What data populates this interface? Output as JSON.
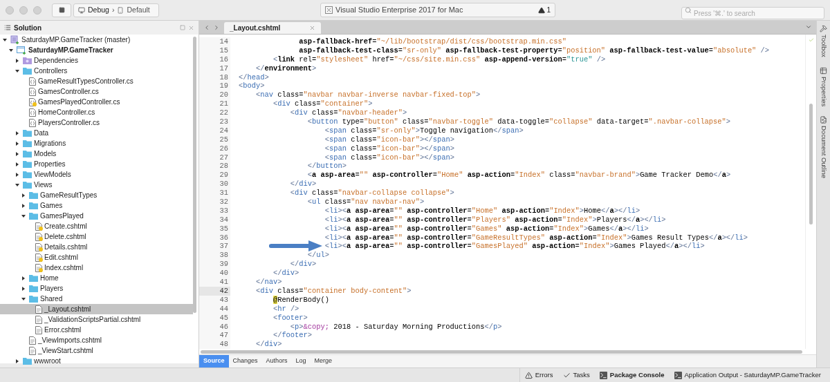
{
  "toolbar": {
    "configuration": "Debug",
    "separator": "›",
    "target": "Default",
    "status": "Visual Studio Enterprise 2017 for Mac",
    "warning_count": "1",
    "search": {
      "placeholder": "Press '⌘.' to search"
    }
  },
  "solution_pad": {
    "title": "Solution",
    "tree": [
      {
        "label": "SaturdayMP.GameTracker (master)",
        "kind": "solution",
        "expanded": true,
        "selected": false,
        "children": [
          {
            "label": "SaturdayMP.GameTracker",
            "kind": "project",
            "expanded": true,
            "selected": false,
            "children": [
              {
                "label": "Dependencies",
                "kind": "dependencies",
                "expanded": false,
                "selected": false
              },
              {
                "label": "Controllers",
                "kind": "folder",
                "expanded": true,
                "selected": false,
                "children": [
                  {
                    "label": "GameResultTypesController.cs",
                    "kind": "cs",
                    "modified": false,
                    "selected": false
                  },
                  {
                    "label": "GamesController.cs",
                    "kind": "cs",
                    "modified": false,
                    "selected": false
                  },
                  {
                    "label": "GamesPlayedController.cs",
                    "kind": "cs",
                    "modified": true,
                    "selected": false
                  },
                  {
                    "label": "HomeController.cs",
                    "kind": "cs",
                    "modified": false,
                    "selected": false
                  },
                  {
                    "label": "PlayersController.cs",
                    "kind": "cs",
                    "modified": false,
                    "selected": false
                  }
                ]
              },
              {
                "label": "Data",
                "kind": "folder",
                "expanded": false,
                "selected": false
              },
              {
                "label": "Migrations",
                "kind": "folder",
                "expanded": false,
                "selected": false
              },
              {
                "label": "Models",
                "kind": "folder",
                "expanded": false,
                "selected": false
              },
              {
                "label": "Properties",
                "kind": "folder",
                "expanded": false,
                "selected": false
              },
              {
                "label": "ViewModels",
                "kind": "folder",
                "expanded": false,
                "selected": false
              },
              {
                "label": "Views",
                "kind": "folder",
                "expanded": true,
                "selected": false,
                "children": [
                  {
                    "label": "GameResultTypes",
                    "kind": "folder",
                    "expanded": false,
                    "selected": false
                  },
                  {
                    "label": "Games",
                    "kind": "folder",
                    "expanded": false,
                    "selected": false
                  },
                  {
                    "label": "GamesPlayed",
                    "kind": "folder",
                    "expanded": true,
                    "selected": false,
                    "children": [
                      {
                        "label": "Create.cshtml",
                        "kind": "cshtml",
                        "modified": true,
                        "selected": false
                      },
                      {
                        "label": "Delete.cshtml",
                        "kind": "cshtml",
                        "modified": true,
                        "selected": false
                      },
                      {
                        "label": "Details.cshtml",
                        "kind": "cshtml",
                        "modified": true,
                        "selected": false
                      },
                      {
                        "label": "Edit.cshtml",
                        "kind": "cshtml",
                        "modified": true,
                        "selected": false
                      },
                      {
                        "label": "Index.cshtml",
                        "kind": "cshtml",
                        "modified": true,
                        "selected": false
                      }
                    ]
                  },
                  {
                    "label": "Home",
                    "kind": "folder",
                    "expanded": false,
                    "selected": false
                  },
                  {
                    "label": "Players",
                    "kind": "folder",
                    "expanded": false,
                    "selected": false
                  },
                  {
                    "label": "Shared",
                    "kind": "folder",
                    "expanded": true,
                    "selected": false,
                    "children": [
                      {
                        "label": "_Layout.cshtml",
                        "kind": "cshtml",
                        "modified": false,
                        "selected": true
                      },
                      {
                        "label": "_ValidationScriptsPartial.cshtml",
                        "kind": "cshtml",
                        "modified": false,
                        "selected": false
                      },
                      {
                        "label": "Error.cshtml",
                        "kind": "cshtml",
                        "modified": false,
                        "selected": false
                      }
                    ]
                  },
                  {
                    "label": "_ViewImports.cshtml",
                    "kind": "cshtml",
                    "modified": false,
                    "selected": false
                  },
                  {
                    "label": "_ViewStart.cshtml",
                    "kind": "cshtml",
                    "modified": false,
                    "selected": false
                  }
                ]
              },
              {
                "label": "wwwroot",
                "kind": "folder",
                "expanded": false,
                "selected": false
              }
            ]
          }
        ]
      }
    ]
  },
  "editor": {
    "tabs": [
      {
        "label": "_Layout.cshtml",
        "selected": true
      }
    ],
    "lines": [
      {
        "number": "14",
        "current": false,
        "marked": false,
        "tokens": [
          {
            "kind": "hattr",
            "text": "              asp-fallback-href"
          },
          {
            "kind": "text",
            "text": "="
          },
          {
            "kind": "string",
            "text": "\"~/lib/bootstrap/dist/css/bootstrap.min.css\""
          }
        ]
      },
      {
        "number": "15",
        "current": false,
        "marked": false,
        "tokens": [
          {
            "kind": "hattr",
            "text": "              asp-fallback-test-class"
          },
          {
            "kind": "text",
            "text": "="
          },
          {
            "kind": "string",
            "text": "\"sr-only\""
          },
          {
            "kind": "hattr",
            "text": " asp-fallback-test-property"
          },
          {
            "kind": "text",
            "text": "="
          },
          {
            "kind": "string",
            "text": "\"position\""
          },
          {
            "kind": "hattr",
            "text": " asp-fallback-test-value"
          },
          {
            "kind": "text",
            "text": "="
          },
          {
            "kind": "string",
            "text": "\"absolute\""
          },
          {
            "kind": "punct",
            "text": " />"
          }
        ]
      },
      {
        "number": "16",
        "current": false,
        "marked": false,
        "tokens": [
          {
            "kind": "punct",
            "text": "        <"
          },
          {
            "kind": "helper",
            "text": "link"
          },
          {
            "kind": "attr",
            "text": " rel"
          },
          {
            "kind": "text",
            "text": "="
          },
          {
            "kind": "string",
            "text": "\"stylesheet\""
          },
          {
            "kind": "attr",
            "text": " href"
          },
          {
            "kind": "text",
            "text": "="
          },
          {
            "kind": "string",
            "text": "\"~/css/site.min.css\""
          },
          {
            "kind": "hattr",
            "text": " asp-append-version"
          },
          {
            "kind": "text",
            "text": "="
          },
          {
            "kind": "literal",
            "text": "\"true\""
          },
          {
            "kind": "punct",
            "text": " />"
          }
        ]
      },
      {
        "number": "17",
        "current": false,
        "marked": false,
        "tokens": [
          {
            "kind": "punct",
            "text": "    </"
          },
          {
            "kind": "helper",
            "text": "environment"
          },
          {
            "kind": "punct",
            "text": ">"
          }
        ]
      },
      {
        "number": "18",
        "current": false,
        "marked": false,
        "tokens": [
          {
            "kind": "punct",
            "text": "</"
          },
          {
            "kind": "tag",
            "text": "head"
          },
          {
            "kind": "punct",
            "text": ">"
          }
        ]
      },
      {
        "number": "19",
        "current": false,
        "marked": false,
        "tokens": [
          {
            "kind": "punct",
            "text": "<"
          },
          {
            "kind": "tag",
            "text": "body"
          },
          {
            "kind": "punct",
            "text": ">"
          }
        ]
      },
      {
        "number": "20",
        "current": false,
        "marked": false,
        "tokens": [
          {
            "kind": "punct",
            "text": "    <"
          },
          {
            "kind": "tag",
            "text": "nav"
          },
          {
            "kind": "attr",
            "text": " class"
          },
          {
            "kind": "text",
            "text": "="
          },
          {
            "kind": "string",
            "text": "\"navbar navbar-inverse navbar-fixed-top\""
          },
          {
            "kind": "punct",
            "text": ">"
          }
        ]
      },
      {
        "number": "21",
        "current": false,
        "marked": false,
        "tokens": [
          {
            "kind": "punct",
            "text": "        <"
          },
          {
            "kind": "tag",
            "text": "div"
          },
          {
            "kind": "attr",
            "text": " class"
          },
          {
            "kind": "text",
            "text": "="
          },
          {
            "kind": "string",
            "text": "\"container\""
          },
          {
            "kind": "punct",
            "text": ">"
          }
        ]
      },
      {
        "number": "22",
        "current": false,
        "marked": false,
        "tokens": [
          {
            "kind": "punct",
            "text": "            <"
          },
          {
            "kind": "tag",
            "text": "div"
          },
          {
            "kind": "attr",
            "text": " class"
          },
          {
            "kind": "text",
            "text": "="
          },
          {
            "kind": "string",
            "text": "\"navbar-header\""
          },
          {
            "kind": "punct",
            "text": ">"
          }
        ]
      },
      {
        "number": "23",
        "current": false,
        "marked": false,
        "tokens": [
          {
            "kind": "punct",
            "text": "                <"
          },
          {
            "kind": "tag",
            "text": "button"
          },
          {
            "kind": "attr",
            "text": " type"
          },
          {
            "kind": "text",
            "text": "="
          },
          {
            "kind": "string",
            "text": "\"button\""
          },
          {
            "kind": "attr",
            "text": " class"
          },
          {
            "kind": "text",
            "text": "="
          },
          {
            "kind": "string",
            "text": "\"navbar-toggle\""
          },
          {
            "kind": "attr",
            "text": " data-toggle"
          },
          {
            "kind": "text",
            "text": "="
          },
          {
            "kind": "string",
            "text": "\"collapse\""
          },
          {
            "kind": "attr",
            "text": " data-target"
          },
          {
            "kind": "text",
            "text": "="
          },
          {
            "kind": "string",
            "text": "\".navbar-collapse\""
          },
          {
            "kind": "punct",
            "text": ">"
          }
        ]
      },
      {
        "number": "24",
        "current": false,
        "marked": false,
        "tokens": [
          {
            "kind": "punct",
            "text": "                    <"
          },
          {
            "kind": "tag",
            "text": "span"
          },
          {
            "kind": "attr",
            "text": " class"
          },
          {
            "kind": "text",
            "text": "="
          },
          {
            "kind": "string",
            "text": "\"sr-only\""
          },
          {
            "kind": "punct",
            "text": ">"
          },
          {
            "kind": "text",
            "text": "Toggle navigation"
          },
          {
            "kind": "punct",
            "text": "</"
          },
          {
            "kind": "tag",
            "text": "span"
          },
          {
            "kind": "punct",
            "text": ">"
          }
        ]
      },
      {
        "number": "25",
        "current": false,
        "marked": false,
        "tokens": [
          {
            "kind": "punct",
            "text": "                    <"
          },
          {
            "kind": "tag",
            "text": "span"
          },
          {
            "kind": "attr",
            "text": " class"
          },
          {
            "kind": "text",
            "text": "="
          },
          {
            "kind": "string",
            "text": "\"icon-bar\""
          },
          {
            "kind": "punct",
            "text": "></"
          },
          {
            "kind": "tag",
            "text": "span"
          },
          {
            "kind": "punct",
            "text": ">"
          }
        ]
      },
      {
        "number": "26",
        "current": false,
        "marked": false,
        "tokens": [
          {
            "kind": "punct",
            "text": "                    <"
          },
          {
            "kind": "tag",
            "text": "span"
          },
          {
            "kind": "attr",
            "text": " class"
          },
          {
            "kind": "text",
            "text": "="
          },
          {
            "kind": "string",
            "text": "\"icon-bar\""
          },
          {
            "kind": "punct",
            "text": "></"
          },
          {
            "kind": "tag",
            "text": "span"
          },
          {
            "kind": "punct",
            "text": ">"
          }
        ]
      },
      {
        "number": "27",
        "current": false,
        "marked": false,
        "tokens": [
          {
            "kind": "punct",
            "text": "                    <"
          },
          {
            "kind": "tag",
            "text": "span"
          },
          {
            "kind": "attr",
            "text": " class"
          },
          {
            "kind": "text",
            "text": "="
          },
          {
            "kind": "string",
            "text": "\"icon-bar\""
          },
          {
            "kind": "punct",
            "text": "></"
          },
          {
            "kind": "tag",
            "text": "span"
          },
          {
            "kind": "punct",
            "text": ">"
          }
        ]
      },
      {
        "number": "28",
        "current": false,
        "marked": false,
        "tokens": [
          {
            "kind": "punct",
            "text": "                </"
          },
          {
            "kind": "tag",
            "text": "button"
          },
          {
            "kind": "punct",
            "text": ">"
          }
        ]
      },
      {
        "number": "29",
        "current": false,
        "marked": false,
        "tokens": [
          {
            "kind": "punct",
            "text": "                <"
          },
          {
            "kind": "helper",
            "text": "a"
          },
          {
            "kind": "hattr",
            "text": " asp-area"
          },
          {
            "kind": "text",
            "text": "="
          },
          {
            "kind": "string",
            "text": "\"\""
          },
          {
            "kind": "hattr",
            "text": " asp-controller"
          },
          {
            "kind": "text",
            "text": "="
          },
          {
            "kind": "string",
            "text": "\"Home\""
          },
          {
            "kind": "hattr",
            "text": " asp-action"
          },
          {
            "kind": "text",
            "text": "="
          },
          {
            "kind": "string",
            "text": "\"Index\""
          },
          {
            "kind": "attr",
            "text": " class"
          },
          {
            "kind": "text",
            "text": "="
          },
          {
            "kind": "string",
            "text": "\"navbar-brand\""
          },
          {
            "kind": "punct",
            "text": ">"
          },
          {
            "kind": "text",
            "text": "Game Tracker Demo"
          },
          {
            "kind": "punct",
            "text": "</"
          },
          {
            "kind": "helper",
            "text": "a"
          },
          {
            "kind": "punct",
            "text": ">"
          }
        ]
      },
      {
        "number": "30",
        "current": false,
        "marked": false,
        "tokens": [
          {
            "kind": "punct",
            "text": "            </"
          },
          {
            "kind": "tag",
            "text": "div"
          },
          {
            "kind": "punct",
            "text": ">"
          }
        ]
      },
      {
        "number": "31",
        "current": false,
        "marked": false,
        "tokens": [
          {
            "kind": "punct",
            "text": "            <"
          },
          {
            "kind": "tag",
            "text": "div"
          },
          {
            "kind": "attr",
            "text": " class"
          },
          {
            "kind": "text",
            "text": "="
          },
          {
            "kind": "string",
            "text": "\"navbar-collapse collapse\""
          },
          {
            "kind": "punct",
            "text": ">"
          }
        ]
      },
      {
        "number": "32",
        "current": false,
        "marked": false,
        "tokens": [
          {
            "kind": "punct",
            "text": "                <"
          },
          {
            "kind": "tag",
            "text": "ul"
          },
          {
            "kind": "attr",
            "text": " class"
          },
          {
            "kind": "text",
            "text": "="
          },
          {
            "kind": "string",
            "text": "\"nav navbar-nav\""
          },
          {
            "kind": "punct",
            "text": ">"
          }
        ]
      },
      {
        "number": "33",
        "current": false,
        "marked": false,
        "tokens": [
          {
            "kind": "punct",
            "text": "                    <"
          },
          {
            "kind": "tag",
            "text": "li"
          },
          {
            "kind": "punct",
            "text": "><"
          },
          {
            "kind": "helper",
            "text": "a"
          },
          {
            "kind": "hattr",
            "text": " asp-area"
          },
          {
            "kind": "text",
            "text": "="
          },
          {
            "kind": "string",
            "text": "\"\""
          },
          {
            "kind": "hattr",
            "text": " asp-controller"
          },
          {
            "kind": "text",
            "text": "="
          },
          {
            "kind": "string",
            "text": "\"Home\""
          },
          {
            "kind": "hattr",
            "text": " asp-action"
          },
          {
            "kind": "text",
            "text": "="
          },
          {
            "kind": "string",
            "text": "\"Index\""
          },
          {
            "kind": "punct",
            "text": ">"
          },
          {
            "kind": "text",
            "text": "Home"
          },
          {
            "kind": "punct",
            "text": "</"
          },
          {
            "kind": "helper",
            "text": "a"
          },
          {
            "kind": "punct",
            "text": "></"
          },
          {
            "kind": "tag",
            "text": "li"
          },
          {
            "kind": "punct",
            "text": ">"
          }
        ]
      },
      {
        "number": "34",
        "current": false,
        "marked": false,
        "tokens": [
          {
            "kind": "punct",
            "text": "                    <"
          },
          {
            "kind": "tag",
            "text": "li"
          },
          {
            "kind": "punct",
            "text": "><"
          },
          {
            "kind": "helper",
            "text": "a"
          },
          {
            "kind": "hattr",
            "text": " asp-area"
          },
          {
            "kind": "text",
            "text": "="
          },
          {
            "kind": "string",
            "text": "\"\""
          },
          {
            "kind": "hattr",
            "text": " asp-controller"
          },
          {
            "kind": "text",
            "text": "="
          },
          {
            "kind": "string",
            "text": "\"Players\""
          },
          {
            "kind": "hattr",
            "text": " asp-action"
          },
          {
            "kind": "text",
            "text": "="
          },
          {
            "kind": "string",
            "text": "\"Index\""
          },
          {
            "kind": "punct",
            "text": ">"
          },
          {
            "kind": "text",
            "text": "Players"
          },
          {
            "kind": "punct",
            "text": "</"
          },
          {
            "kind": "helper",
            "text": "a"
          },
          {
            "kind": "punct",
            "text": "></"
          },
          {
            "kind": "tag",
            "text": "li"
          },
          {
            "kind": "punct",
            "text": ">"
          }
        ]
      },
      {
        "number": "35",
        "current": false,
        "marked": false,
        "tokens": [
          {
            "kind": "punct",
            "text": "                    <"
          },
          {
            "kind": "tag",
            "text": "li"
          },
          {
            "kind": "punct",
            "text": "><"
          },
          {
            "kind": "helper",
            "text": "a"
          },
          {
            "kind": "hattr",
            "text": " asp-area"
          },
          {
            "kind": "text",
            "text": "="
          },
          {
            "kind": "string",
            "text": "\"\""
          },
          {
            "kind": "hattr",
            "text": " asp-controller"
          },
          {
            "kind": "text",
            "text": "="
          },
          {
            "kind": "string",
            "text": "\"Games\""
          },
          {
            "kind": "hattr",
            "text": " asp-action"
          },
          {
            "kind": "text",
            "text": "="
          },
          {
            "kind": "string",
            "text": "\"Index\""
          },
          {
            "kind": "punct",
            "text": ">"
          },
          {
            "kind": "text",
            "text": "Games"
          },
          {
            "kind": "punct",
            "text": "</"
          },
          {
            "kind": "helper",
            "text": "a"
          },
          {
            "kind": "punct",
            "text": "></"
          },
          {
            "kind": "tag",
            "text": "li"
          },
          {
            "kind": "punct",
            "text": ">"
          }
        ]
      },
      {
        "number": "36",
        "current": false,
        "marked": false,
        "tokens": [
          {
            "kind": "punct",
            "text": "                    <"
          },
          {
            "kind": "tag",
            "text": "li"
          },
          {
            "kind": "punct",
            "text": "><"
          },
          {
            "kind": "helper",
            "text": "a"
          },
          {
            "kind": "hattr",
            "text": " asp-area"
          },
          {
            "kind": "text",
            "text": "="
          },
          {
            "kind": "string",
            "text": "\"\""
          },
          {
            "kind": "hattr",
            "text": " asp-controller"
          },
          {
            "kind": "text",
            "text": "="
          },
          {
            "kind": "string",
            "text": "\"GameResultTypes\""
          },
          {
            "kind": "hattr",
            "text": " asp-action"
          },
          {
            "kind": "text",
            "text": "="
          },
          {
            "kind": "string",
            "text": "\"Index\""
          },
          {
            "kind": "punct",
            "text": ">"
          },
          {
            "kind": "text",
            "text": "Games Result Types"
          },
          {
            "kind": "punct",
            "text": "</"
          },
          {
            "kind": "helper",
            "text": "a"
          },
          {
            "kind": "punct",
            "text": "></"
          },
          {
            "kind": "tag",
            "text": "li"
          },
          {
            "kind": "punct",
            "text": ">"
          }
        ]
      },
      {
        "number": "37",
        "current": false,
        "marked": true,
        "tokens": [
          {
            "kind": "punct",
            "text": "                    <"
          },
          {
            "kind": "tag",
            "text": "li"
          },
          {
            "kind": "punct",
            "text": "><"
          },
          {
            "kind": "helper",
            "text": "a"
          },
          {
            "kind": "hattr",
            "text": " asp-area"
          },
          {
            "kind": "text",
            "text": "="
          },
          {
            "kind": "string",
            "text": "\"\""
          },
          {
            "kind": "hattr",
            "text": " asp-controller"
          },
          {
            "kind": "text",
            "text": "="
          },
          {
            "kind": "string",
            "text": "\"GamesPlayed\""
          },
          {
            "kind": "hattr",
            "text": " asp-action"
          },
          {
            "kind": "text",
            "text": "="
          },
          {
            "kind": "string",
            "text": "\"Index\""
          },
          {
            "kind": "punct",
            "text": ">"
          },
          {
            "kind": "text",
            "text": "Games Played"
          },
          {
            "kind": "punct",
            "text": "</"
          },
          {
            "kind": "helper",
            "text": "a"
          },
          {
            "kind": "punct",
            "text": "></"
          },
          {
            "kind": "tag",
            "text": "li"
          },
          {
            "kind": "punct",
            "text": ">"
          }
        ]
      },
      {
        "number": "38",
        "current": false,
        "marked": false,
        "tokens": [
          {
            "kind": "punct",
            "text": "                </"
          },
          {
            "kind": "tag",
            "text": "ul"
          },
          {
            "kind": "punct",
            "text": ">"
          }
        ]
      },
      {
        "number": "39",
        "current": false,
        "marked": false,
        "tokens": [
          {
            "kind": "punct",
            "text": "            </"
          },
          {
            "kind": "tag",
            "text": "div"
          },
          {
            "kind": "punct",
            "text": ">"
          }
        ]
      },
      {
        "number": "40",
        "current": false,
        "marked": false,
        "tokens": [
          {
            "kind": "punct",
            "text": "        </"
          },
          {
            "kind": "tag",
            "text": "div"
          },
          {
            "kind": "punct",
            "text": ">"
          }
        ]
      },
      {
        "number": "41",
        "current": false,
        "marked": false,
        "tokens": [
          {
            "kind": "punct",
            "text": "    </"
          },
          {
            "kind": "tag",
            "text": "nav"
          },
          {
            "kind": "punct",
            "text": ">"
          }
        ]
      },
      {
        "number": "42",
        "current": true,
        "marked": false,
        "tokens": [
          {
            "kind": "punct",
            "text": "    <"
          },
          {
            "kind": "tag",
            "text": "div"
          },
          {
            "kind": "attr",
            "text": " class"
          },
          {
            "kind": "text",
            "text": "="
          },
          {
            "kind": "string",
            "text": "\"container body-content\""
          },
          {
            "kind": "punct",
            "text": ">"
          }
        ]
      },
      {
        "number": "43",
        "current": false,
        "marked": false,
        "tokens": [
          {
            "kind": "razor",
            "text": "        @"
          },
          {
            "kind": "text",
            "text": "RenderBody()"
          }
        ]
      },
      {
        "number": "44",
        "current": false,
        "marked": false,
        "tokens": [
          {
            "kind": "punct",
            "text": "        <"
          },
          {
            "kind": "tag",
            "text": "hr"
          },
          {
            "kind": "punct",
            "text": " />"
          }
        ]
      },
      {
        "number": "45",
        "current": false,
        "marked": false,
        "tokens": [
          {
            "kind": "punct",
            "text": "        <"
          },
          {
            "kind": "tag",
            "text": "footer"
          },
          {
            "kind": "punct",
            "text": ">"
          }
        ]
      },
      {
        "number": "46",
        "current": false,
        "marked": false,
        "tokens": [
          {
            "kind": "punct",
            "text": "            <"
          },
          {
            "kind": "tag",
            "text": "p"
          },
          {
            "kind": "punct",
            "text": ">"
          },
          {
            "kind": "entity",
            "text": "&copy;"
          },
          {
            "kind": "text",
            "text": " 2018 - Saturday Morning Productions"
          },
          {
            "kind": "punct",
            "text": "</"
          },
          {
            "kind": "tag",
            "text": "p"
          },
          {
            "kind": "punct",
            "text": ">"
          }
        ]
      },
      {
        "number": "47",
        "current": false,
        "marked": false,
        "tokens": [
          {
            "kind": "punct",
            "text": "        </"
          },
          {
            "kind": "tag",
            "text": "footer"
          },
          {
            "kind": "punct",
            "text": ">"
          }
        ]
      },
      {
        "number": "48",
        "current": false,
        "marked": false,
        "tokens": [
          {
            "kind": "punct",
            "text": "    </"
          },
          {
            "kind": "tag",
            "text": "div"
          },
          {
            "kind": "punct",
            "text": ">"
          }
        ]
      }
    ],
    "bottom_tabs": [
      {
        "label": "Source",
        "selected": true
      },
      {
        "label": "Changes",
        "selected": false
      },
      {
        "label": "Authors",
        "selected": false
      },
      {
        "label": "Log",
        "selected": false
      },
      {
        "label": "Merge",
        "selected": false
      }
    ]
  },
  "side_pads": [
    {
      "label": "Toolbox",
      "kind": "toolbox"
    },
    {
      "label": "Properties",
      "kind": "properties"
    },
    {
      "label": "Document Outline",
      "kind": "outline"
    }
  ],
  "status_bar": [
    {
      "label": "Errors",
      "kind": "errors",
      "bold": false
    },
    {
      "label": "Tasks",
      "kind": "tasks",
      "bold": false
    },
    {
      "label": "Package Console",
      "kind": "console",
      "bold": true
    },
    {
      "label": "Application Output - SaturdayMP.GameTracker",
      "kind": "console",
      "bold": false
    }
  ]
}
